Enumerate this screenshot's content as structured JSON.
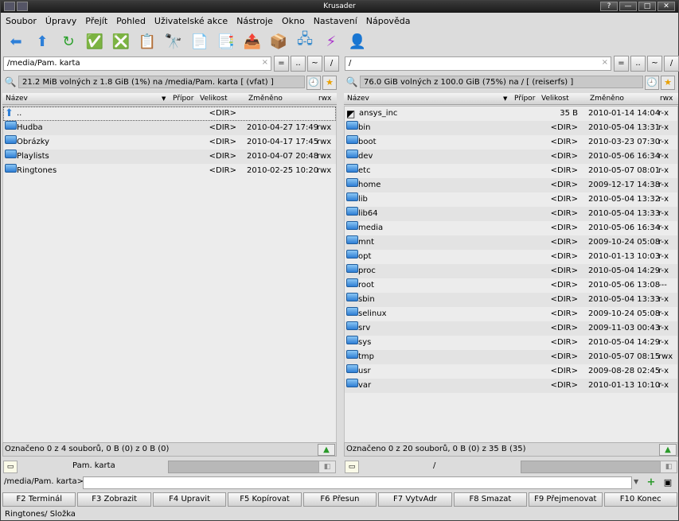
{
  "window": {
    "title": "Krusader",
    "btn_help": "?",
    "btn_min": "—",
    "btn_max": "□",
    "btn_close": "✕"
  },
  "menu": [
    "Soubor",
    "Úpravy",
    "Přejít",
    "Pohled",
    "Uživatelské akce",
    "Nástroje",
    "Okno",
    "Nastavení",
    "Nápověda"
  ],
  "toolbar": [
    {
      "icon": "back-arrow-icon",
      "glyph": "⬅",
      "color": "#2d7fd8"
    },
    {
      "icon": "up-arrow-icon",
      "glyph": "⬆",
      "color": "#2d7fd8"
    },
    {
      "icon": "refresh-icon",
      "glyph": "↻",
      "color": "#2aa02a"
    },
    {
      "icon": "select-icon",
      "glyph": "✅",
      "color": "#3a3"
    },
    {
      "icon": "unselect-icon",
      "glyph": "❎",
      "color": "#d33"
    },
    {
      "icon": "compare-icon",
      "glyph": "📋",
      "color": "#cc0"
    },
    {
      "icon": "search-icon",
      "glyph": "🔭",
      "color": "#333"
    },
    {
      "icon": "new-file-icon",
      "glyph": "📄",
      "color": "#3a3"
    },
    {
      "icon": "copy-icon",
      "glyph": "📑",
      "color": "#555"
    },
    {
      "icon": "move-icon",
      "glyph": "📤",
      "color": "#c80"
    },
    {
      "icon": "pack-icon",
      "glyph": "📦",
      "color": "#c80"
    },
    {
      "icon": "network-icon",
      "glyph": "🖧",
      "color": "#38c"
    },
    {
      "icon": "sync-icon",
      "glyph": "⚡",
      "color": "#a3c"
    },
    {
      "icon": "root-mode-icon",
      "glyph": "👤",
      "color": "#c93"
    }
  ],
  "left": {
    "path": "/media/Pam. karta",
    "pbtns": [
      "=",
      "..",
      "~",
      "/"
    ],
    "info": "21.2 MiB volných z 1.8 GiB (1%) na /media/Pam. karta [ (vfat) ]",
    "cols": {
      "name": "Název",
      "ext": "Přípor",
      "size": "Velikost",
      "mod": "Změněno",
      "rwx": "rwx"
    },
    "rows": [
      {
        "name": "..",
        "size": "<DIR>",
        "mod": "",
        "rwx": "",
        "kind": "up"
      },
      {
        "name": "Hudba",
        "size": "<DIR>",
        "mod": "2010-04-27 17:49",
        "rwx": "rwx",
        "kind": "dir"
      },
      {
        "name": "Obrázky",
        "size": "<DIR>",
        "mod": "2010-04-17 17:45",
        "rwx": "rwx",
        "kind": "dir"
      },
      {
        "name": "Playlists",
        "size": "<DIR>",
        "mod": "2010-04-07 20:48",
        "rwx": "rwx",
        "kind": "dir"
      },
      {
        "name": "Ringtones",
        "size": "<DIR>",
        "mod": "2010-02-25 10:20",
        "rwx": "rwx",
        "kind": "dir"
      }
    ],
    "status": "Označeno 0 z 4 souborů, 0 B  (0) z 0 B (0)",
    "bottom_label": "Pam. karta"
  },
  "right": {
    "path": "/",
    "pbtns": [
      "=",
      "..",
      "~",
      "/"
    ],
    "info": "76.0 GiB volných z 100.0 GiB (75%) na / [ (reiserfs) ]",
    "cols": {
      "name": "Název",
      "ext": "Přípor",
      "size": "Velikost",
      "mod": "Změněno",
      "rwx": "rwx"
    },
    "rows": [
      {
        "name": "ansys_inc",
        "size": "35 B",
        "mod": "2010-01-14 14:04",
        "rwx": "r-x",
        "kind": "link"
      },
      {
        "name": "bin",
        "size": "<DIR>",
        "mod": "2010-05-04 13:31",
        "rwx": "r-x",
        "kind": "dir"
      },
      {
        "name": "boot",
        "size": "<DIR>",
        "mod": "2010-03-23 07:30",
        "rwx": "r-x",
        "kind": "dir"
      },
      {
        "name": "dev",
        "size": "<DIR>",
        "mod": "2010-05-06 16:34",
        "rwx": "r-x",
        "kind": "dir"
      },
      {
        "name": "etc",
        "size": "<DIR>",
        "mod": "2010-05-07 08:01",
        "rwx": "r-x",
        "kind": "dir"
      },
      {
        "name": "home",
        "size": "<DIR>",
        "mod": "2009-12-17 14:38",
        "rwx": "r-x",
        "kind": "dir"
      },
      {
        "name": "lib",
        "size": "<DIR>",
        "mod": "2010-05-04 13:32",
        "rwx": "r-x",
        "kind": "dir"
      },
      {
        "name": "lib64",
        "size": "<DIR>",
        "mod": "2010-05-04 13:33",
        "rwx": "r-x",
        "kind": "dir"
      },
      {
        "name": "media",
        "size": "<DIR>",
        "mod": "2010-05-06 16:34",
        "rwx": "r-x",
        "kind": "dir"
      },
      {
        "name": "mnt",
        "size": "<DIR>",
        "mod": "2009-10-24 05:08",
        "rwx": "r-x",
        "kind": "dir"
      },
      {
        "name": "opt",
        "size": "<DIR>",
        "mod": "2010-01-13 10:03",
        "rwx": "r-x",
        "kind": "dir"
      },
      {
        "name": "proc",
        "size": "<DIR>",
        "mod": "2010-05-04 14:29",
        "rwx": "r-x",
        "kind": "dir"
      },
      {
        "name": "root",
        "size": "<DIR>",
        "mod": "2010-05-06 13:08",
        "rwx": "---",
        "kind": "dir"
      },
      {
        "name": "sbin",
        "size": "<DIR>",
        "mod": "2010-05-04 13:33",
        "rwx": "r-x",
        "kind": "dir"
      },
      {
        "name": "selinux",
        "size": "<DIR>",
        "mod": "2009-10-24 05:08",
        "rwx": "r-x",
        "kind": "dir"
      },
      {
        "name": "srv",
        "size": "<DIR>",
        "mod": "2009-11-03 00:43",
        "rwx": "r-x",
        "kind": "dir"
      },
      {
        "name": "sys",
        "size": "<DIR>",
        "mod": "2010-05-04 14:29",
        "rwx": "r-x",
        "kind": "dir"
      },
      {
        "name": "tmp",
        "size": "<DIR>",
        "mod": "2010-05-07 08:15",
        "rwx": "rwx",
        "kind": "dir"
      },
      {
        "name": "usr",
        "size": "<DIR>",
        "mod": "2009-08-28 02:45",
        "rwx": "r-x",
        "kind": "dir"
      },
      {
        "name": "var",
        "size": "<DIR>",
        "mod": "2010-01-13 10:10",
        "rwx": "r-x",
        "kind": "dir"
      }
    ],
    "status": "Označeno 0 z 20 souborů, 0 B  (0) z 35 B (35)",
    "bottom_label": "/"
  },
  "cmd": {
    "label": "/media/Pam. karta>",
    "value": ""
  },
  "fkeys": [
    "F2 Terminál",
    "F3 Zobrazit",
    "F4 Upravit",
    "F5 Kopírovat",
    "F6 Přesun",
    "F7 VytvAdr",
    "F8 Smazat",
    "F9 Přejmenovat",
    "F10 Konec"
  ],
  "statusbar": "Ringtones/  Složka"
}
